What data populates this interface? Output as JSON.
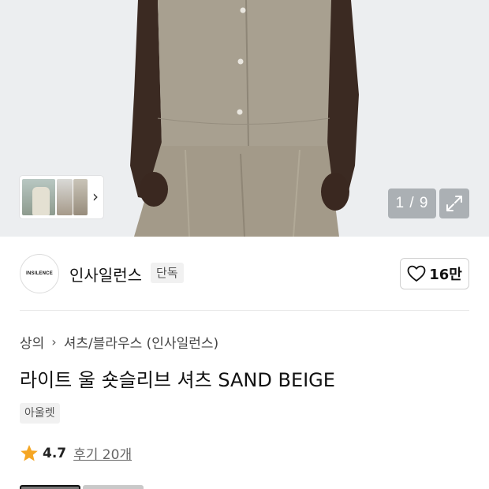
{
  "gallery": {
    "page_current": "1",
    "page_total": "9",
    "page_separator": "/",
    "thumbnail_next_icon": "chevron-right-icon",
    "expand_icon": "expand-arrows-icon"
  },
  "brand": {
    "logo_text": "INSILENCE",
    "name": "인사일런스",
    "badge": "단독",
    "like_icon": "heart-outline-icon",
    "like_count": "16만"
  },
  "breadcrumb": {
    "category": "상의",
    "separator_icon": "chevron-right-icon",
    "subcategory": "셔츠/블라우스 (인사일런스)"
  },
  "product": {
    "title": "라이트 울 숏슬리브 셔츠 SAND BEIGE",
    "tag": "아울렛"
  },
  "rating": {
    "star_icon": "star-icon",
    "value": "4.7",
    "review_link": "후기 20개"
  },
  "colors": {
    "star": "#f5a623",
    "garment": "#a59c8c"
  }
}
